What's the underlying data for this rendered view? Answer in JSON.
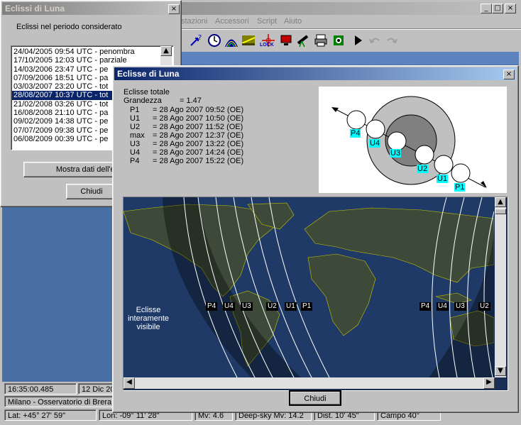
{
  "main_window": {
    "menu": [
      "stazioni",
      "Accessori",
      "Script",
      "Aiuto"
    ],
    "toolbar_icons": [
      "question-arrow-icon",
      "clock-icon",
      "meridian-icon",
      "horizon-icon",
      "target-icon",
      "lock-icon",
      "monitor-icon",
      "telescope-icon",
      "printer-icon",
      "settings-icon",
      "play-icon",
      "undo-icon",
      "redo-icon"
    ],
    "toolbar_lock_label": "LOCK",
    "window_buttons": [
      "_",
      "□",
      "×"
    ]
  },
  "eclipse_list_window": {
    "title": "Eclissi di Luna",
    "close": "×",
    "heading": "Eclissi nel periodo considerato",
    "items": [
      "24/04/2005  09:54 UTC  - penombra",
      "17/10/2005  12:03 UTC  - parziale",
      "14/03/2006  23:47 UTC  - pe",
      "07/09/2006  18:51 UTC  - pa",
      "03/03/2007  23:20 UTC  - tot",
      "28/08/2007  10:37 UTC  - tot",
      "21/02/2008  03:26 UTC  - tot",
      "16/08/2008  21:10 UTC  - pa",
      "09/02/2009  14:38 UTC  - pe",
      "07/07/2009  09:38 UTC  - pe",
      "06/08/2009  00:39 UTC  - pe"
    ],
    "selected_index": 5,
    "show_data_button": "Mostra dati dell'ec",
    "close_button": "Chiudi"
  },
  "eclipse_detail_window": {
    "title": "Eclisse di Luna",
    "close": "×",
    "type": "Eclisse totale",
    "magnitude_label": "Grandezza",
    "magnitude_value": "= 1.47",
    "contacts": [
      {
        "name": "P1",
        "time": "= 28 Ago 2007  09:52 (OE)"
      },
      {
        "name": "U1",
        "time": "= 28 Ago 2007  10:50 (OE)"
      },
      {
        "name": "U2",
        "time": "= 28 Ago 2007  11:52 (OE)"
      },
      {
        "name": "max",
        "time": "= 28 Ago 2007  12:37 (OE)"
      },
      {
        "name": "U3",
        "time": "= 28 Ago 2007  13:22 (OE)"
      },
      {
        "name": "U4",
        "time": "= 28 Ago 2007  14:24 (OE)"
      },
      {
        "name": "P4",
        "time": "= 28 Ago 2007  15:22 (OE)"
      }
    ],
    "diagram_labels": [
      "P4",
      "U4",
      "U3",
      "U2",
      "U1",
      "P1"
    ],
    "map_labels_left": [
      "P4",
      "U4",
      "U3",
      "U2",
      "U1",
      "P1"
    ],
    "map_labels_right": [
      "P4",
      "U4",
      "U3",
      "U2"
    ],
    "map_caption": [
      "Eclisse",
      "interamente",
      "visibile"
    ],
    "close_button": "Chiudi"
  },
  "status_bar": {
    "time": "16:35:00.485",
    "date": "12 Dic 20",
    "location": "Milano - Osservatorio di Brera",
    "lat": "Lat: +45° 27' 59\"",
    "lon": "Lon: -09° 11' 28\"",
    "mv": "Mv: 4.6",
    "deepsky": "Deep-sky Mv: 14.2",
    "dist": "Dist. 10' 45\"",
    "campo": "Campo 40°"
  },
  "colors": {
    "selection": "#0a246a",
    "titlebar_active_start": "#0a246a",
    "titlebar_active_end": "#a6caf0",
    "titlebar_inactive": "#808080",
    "label_bg": "#00ffff"
  }
}
